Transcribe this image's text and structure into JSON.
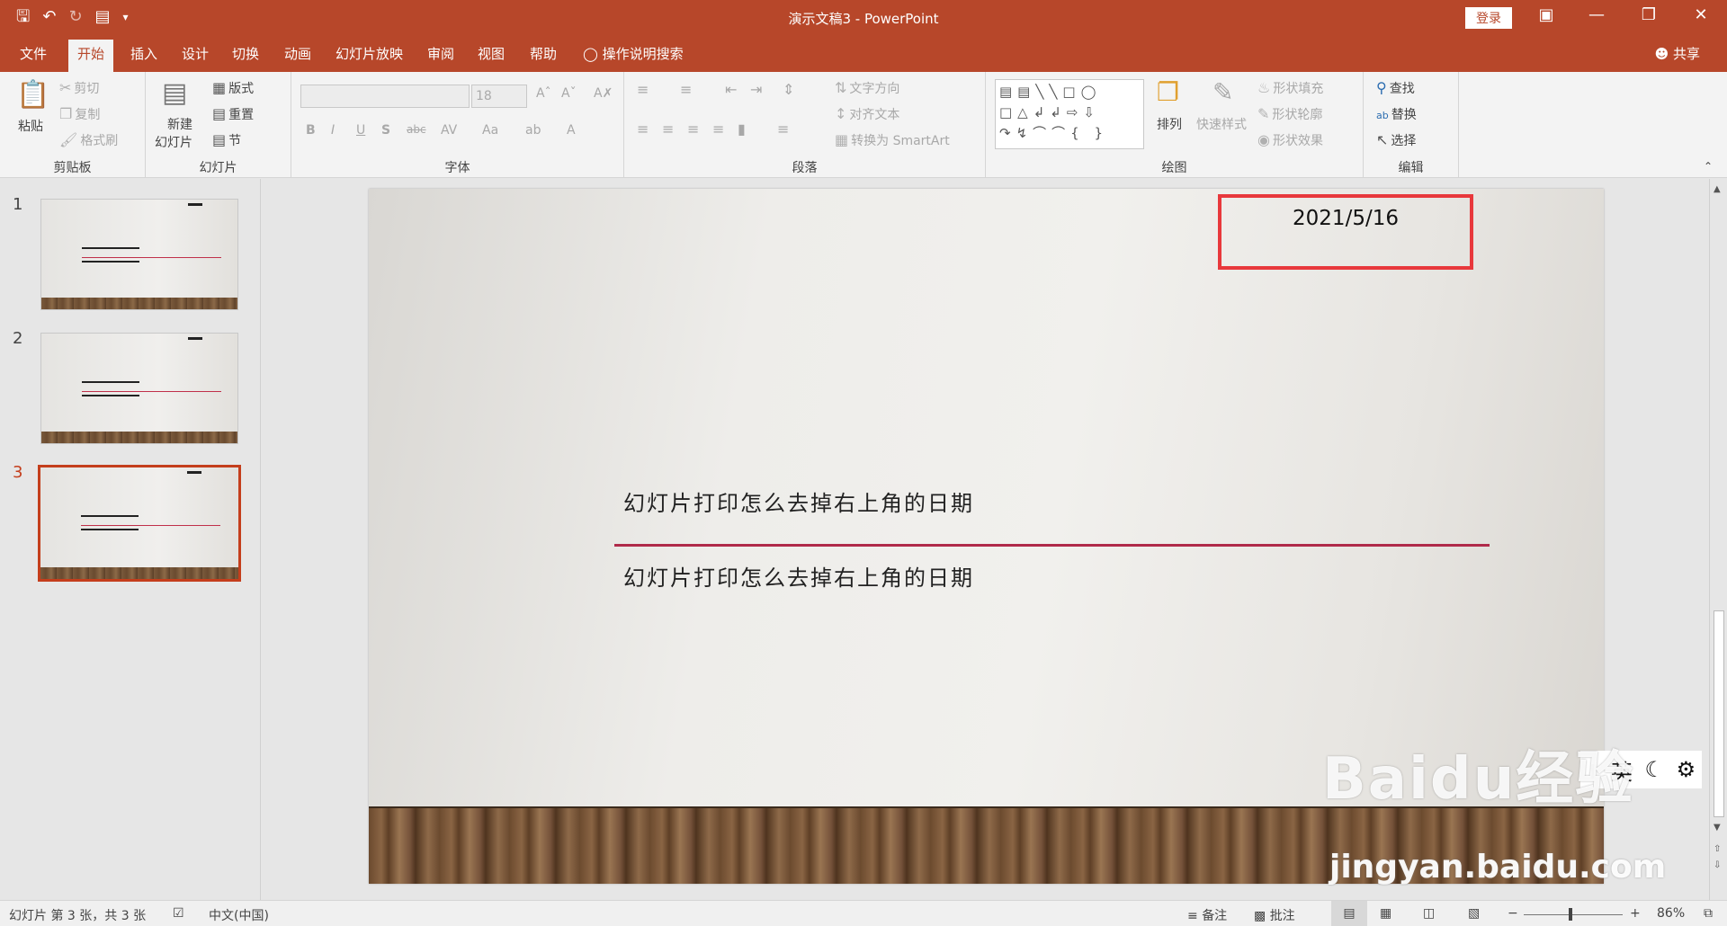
{
  "app": {
    "title": "演示文稿3  -  PowerPoint",
    "login": "登录",
    "accent": "#b7472a"
  },
  "qat": {
    "save_icon": "save-icon",
    "undo_icon": "undo-icon",
    "redo_icon": "redo-icon",
    "present_icon": "present-icon",
    "customize_icon": "customize-icon"
  },
  "menu": {
    "tabs": [
      "文件",
      "开始",
      "插入",
      "设计",
      "切换",
      "动画",
      "幻灯片放映",
      "审阅",
      "视图",
      "帮助"
    ],
    "active_tab": "开始",
    "tell_me": "操作说明搜索",
    "share": "共享"
  },
  "ribbon": {
    "clipboard": {
      "paste": "粘贴",
      "cut": "剪切",
      "copy": "复制",
      "format_painter": "格式刷",
      "label": "剪贴板"
    },
    "slides": {
      "new_slide_line1": "新建",
      "new_slide_line2": "幻灯片",
      "layout": "版式",
      "reset": "重置",
      "section": "节",
      "label": "幻灯片"
    },
    "font": {
      "font_size": "18",
      "label": "字体"
    },
    "paragraph": {
      "text_direction": "文字方向",
      "align_text": "对齐文本",
      "smartart": "转换为 SmartArt",
      "label": "段落"
    },
    "drawing": {
      "arrange": "排列",
      "quick_styles": "快速样式",
      "shape_fill": "形状填充",
      "shape_outline": "形状轮廓",
      "shape_effects": "形状效果",
      "label": "绘图"
    },
    "editing": {
      "find": "查找",
      "replace": "替换",
      "select": "选择",
      "label": "编辑"
    }
  },
  "slides_pane": {
    "numbers": [
      "1",
      "2",
      "3"
    ],
    "active": 3
  },
  "slide": {
    "date": "2021/5/16",
    "title": "幻灯片打印怎么去掉右上角的日期",
    "subtitle": "幻灯片打印怎么去掉右上角的日期",
    "highlight_color": "#e8383c"
  },
  "ime": {
    "lang": "英"
  },
  "status": {
    "slide_info": "幻灯片 第 3 张，共 3 张",
    "language": "中文(中国)",
    "notes": "备注",
    "comments": "批注",
    "zoom": "86%"
  },
  "watermark": {
    "brand": "Baidu经验",
    "url": "jingyan.baidu.com"
  }
}
